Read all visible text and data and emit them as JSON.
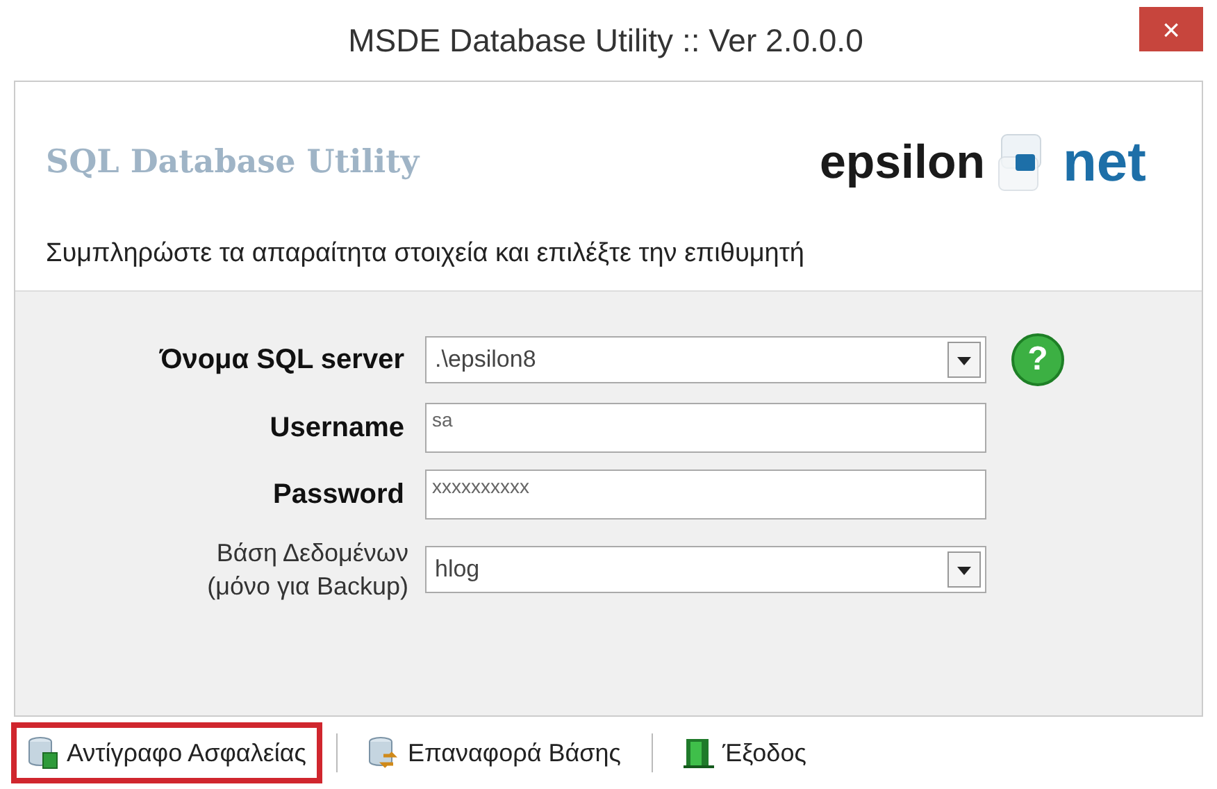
{
  "window": {
    "title": "MSDE Database Utility :: Ver 2.0.0.0",
    "close": "×"
  },
  "header": {
    "title": "SQL Database Utility",
    "logo_left": "epsilon",
    "logo_right": "net",
    "instructions": "Συμπληρώστε τα απαραίτητα στοιχεία και επιλέξτε την επιθυμητή"
  },
  "fields": [
    {
      "kind": "combo",
      "label": "Όνομα SQL server",
      "bold": true,
      "value": ".\\epsilon8",
      "help": "?"
    },
    {
      "kind": "text",
      "label": "Username",
      "bold": true,
      "value": "sa"
    },
    {
      "kind": "text",
      "label": "Password",
      "bold": true,
      "value": "xxxxxxxxxx"
    },
    {
      "kind": "combo",
      "label": "Βάση  Δεδομένων (μόνο για Backup)",
      "bold": false,
      "value": "hlog"
    }
  ],
  "toolbar": [
    {
      "kind": "backup",
      "label": "Αντίγραφο Ασφαλείας",
      "highlighted": true
    },
    {
      "kind": "restore",
      "label": "Επαναφορά Βάσης",
      "highlighted": false
    },
    {
      "kind": "exit",
      "label": "Έξοδος",
      "highlighted": false
    }
  ]
}
